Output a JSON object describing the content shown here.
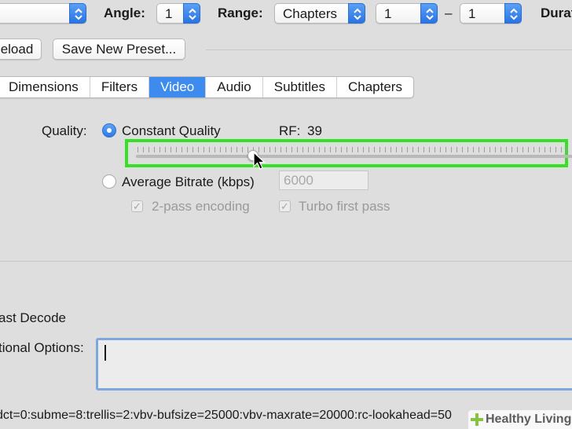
{
  "toolbar": {
    "title_popup_value": "",
    "angle_label": "Angle:",
    "angle_value": "1",
    "range_label": "Range:",
    "range_value": "Chapters",
    "range_start": "1",
    "range_dash": "–",
    "range_end": "1",
    "duration_label": "Durat"
  },
  "presets": {
    "reload_label": "eload",
    "save_new_label": "Save New Preset..."
  },
  "tabs": [
    {
      "label": "Dimensions"
    },
    {
      "label": "Filters"
    },
    {
      "label": "Video",
      "active": true
    },
    {
      "label": "Audio"
    },
    {
      "label": "Subtitles"
    },
    {
      "label": "Chapters"
    }
  ],
  "video": {
    "quality_label": "Quality:",
    "constant_quality_label": "Constant Quality",
    "rf_label": "RF:",
    "rf_value": "39",
    "average_bitrate_label": "Average Bitrate (kbps)",
    "bitrate_value": "6000",
    "two_pass_label": "2-pass encoding",
    "turbo_label": "Turbo first pass",
    "fast_decode_label": "ast Decode",
    "additional_options_label": "tional Options:",
    "options_value": "",
    "encoder_string": "dct=0:subme=8:trellis=2:vbv-bufsize=25000:vbv-maxrate=20000:rc-lookahead=50"
  },
  "watermark": {
    "text": "Healthy Living"
  },
  "colors": {
    "accent": "#3d8bef",
    "highlight": "#35e025",
    "background": "#dedede"
  }
}
